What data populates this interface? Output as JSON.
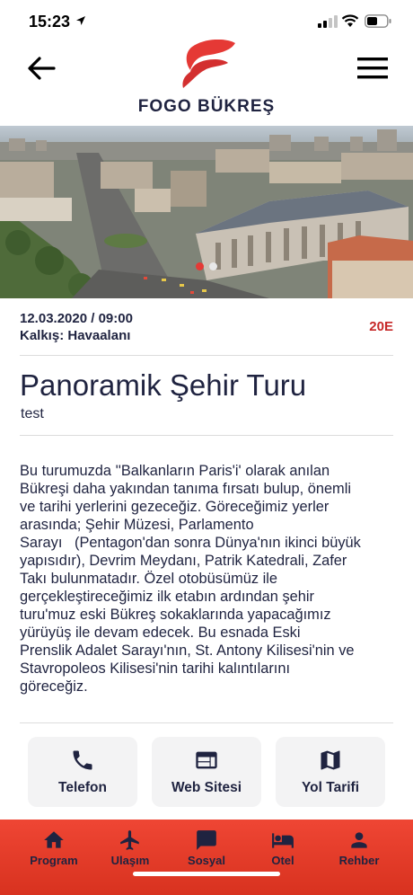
{
  "status": {
    "time": "15:23",
    "icons": [
      "location-arrow-icon",
      "signal-icon",
      "wifi-icon",
      "battery-icon"
    ]
  },
  "header": {
    "brand": "FOGO BÜKREŞ",
    "back_icon": "arrow-left-icon",
    "menu_icon": "hamburger-menu-icon",
    "logo": "fogo-flame-logo",
    "logo_color": "#e53935"
  },
  "hero": {
    "image": "aerial city view of Bucharest",
    "slides": 2,
    "active_slide": 1
  },
  "tour": {
    "date": "12.03.2020 / 09:00",
    "departure": "Kalkış: Havaalanı",
    "price": "20E",
    "title": "Panoramik Şehir Turu",
    "subtitle": "test",
    "description_lines": [
      "Bu turumuzda ''Balkanların Paris'i' olarak anılan",
      "Bükreşi daha yakından tanıma fırsatı bulup, önemli",
      "ve tarihi yerlerini gezeceğiz. Göreceğimiz yerler",
      "arasında; Şehir Müzesi, Parlamento",
      "Sarayı   (Pentagon'dan sonra Dünya'nın ikinci büyük",
      "yapısıdır), Devrim Meydanı, Patrik Katedrali, Zafer",
      "Takı bulunmatadır. Özel otobüsümüz ile",
      "gerçekleştireceğimiz ilk etabın ardından şehir",
      "turu'muz eski Bükreş sokaklarında yapacağımız",
      "yürüyüş ile devam edecek. Bu esnada Eski",
      "Prenslik Adalet Sarayı'nın, St. Antony Kilisesi'nin ve",
      "Stavropoleos Kilisesi'nin tarihi kalıntılarını",
      "göreceğiz."
    ]
  },
  "actions": [
    {
      "label": "Telefon",
      "icon": "phone-icon"
    },
    {
      "label": "Web Sitesi",
      "icon": "web-browser-icon"
    },
    {
      "label": "Yol Tarifi",
      "icon": "map-icon"
    }
  ],
  "nav": [
    {
      "label": "Program",
      "icon": "home-icon"
    },
    {
      "label": "Ulaşım",
      "icon": "airplane-icon"
    },
    {
      "label": "Sosyal",
      "icon": "chat-icon"
    },
    {
      "label": "Otel",
      "icon": "hotel-bed-icon"
    },
    {
      "label": "Rehber",
      "icon": "person-icon"
    }
  ],
  "colors": {
    "accent": "#e53935",
    "price": "#c62828",
    "text": "#1f2340",
    "nav_bg": "#e23f2c",
    "button_bg": "#f3f3f4"
  }
}
